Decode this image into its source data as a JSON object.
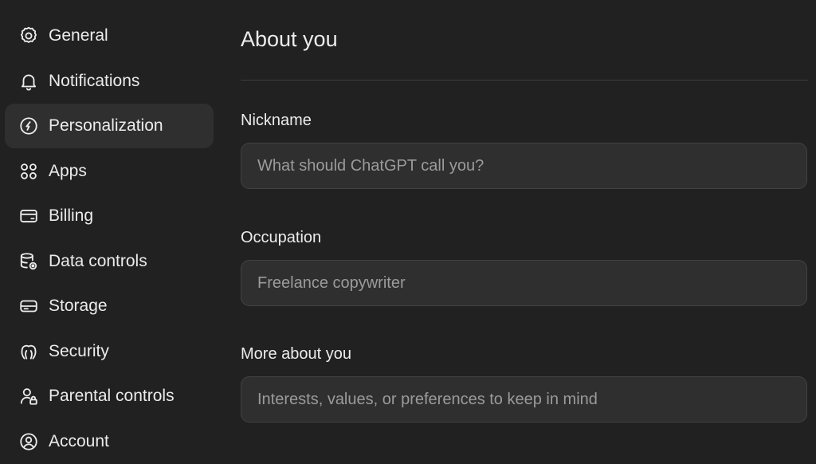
{
  "sidebar": {
    "items": [
      {
        "label": "General",
        "icon": "gear-icon",
        "active": false
      },
      {
        "label": "Notifications",
        "icon": "bell-icon",
        "active": false
      },
      {
        "label": "Personalization",
        "icon": "personalization-icon",
        "active": true
      },
      {
        "label": "Apps",
        "icon": "apps-grid-icon",
        "active": false
      },
      {
        "label": "Billing",
        "icon": "credit-card-icon",
        "active": false
      },
      {
        "label": "Data controls",
        "icon": "database-gear-icon",
        "active": false
      },
      {
        "label": "Storage",
        "icon": "storage-drive-icon",
        "active": false
      },
      {
        "label": "Security",
        "icon": "security-icon",
        "active": false
      },
      {
        "label": "Parental controls",
        "icon": "parental-user-icon",
        "active": false
      },
      {
        "label": "Account",
        "icon": "account-icon",
        "active": false
      }
    ]
  },
  "main": {
    "title": "About you",
    "fields": {
      "nickname": {
        "label": "Nickname",
        "value": "",
        "placeholder": "What should ChatGPT call you?"
      },
      "occupation": {
        "label": "Occupation",
        "value": "",
        "placeholder": "Freelance copywriter"
      },
      "more_about": {
        "label": "More about you",
        "value": "",
        "placeholder": "Interests, values, or preferences to keep in mind"
      }
    }
  },
  "colors": {
    "background": "#212121",
    "sidebar_active": "#2f2f2f",
    "input_background": "#2f2f2f",
    "input_border": "#424242",
    "text": "#ececec",
    "placeholder": "#9b9b9b"
  }
}
